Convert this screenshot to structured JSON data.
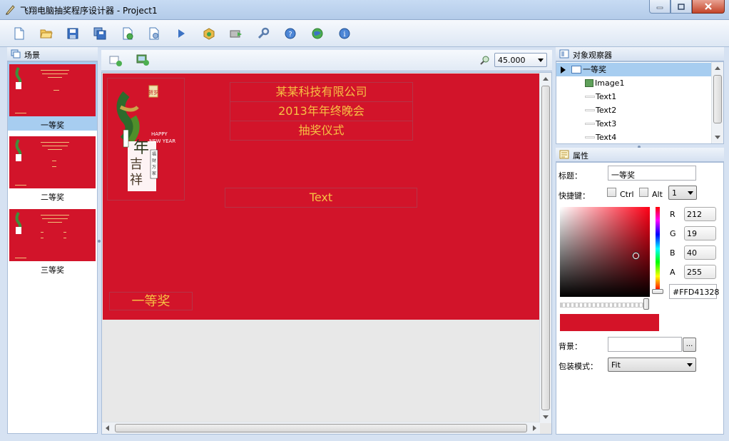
{
  "window": {
    "title": "飞翔电脑抽奖程序设计器 - Project1"
  },
  "colors": {
    "stage_red": "#D2142A",
    "text_gold": "#F6C043",
    "selection": "#A7CDF0"
  },
  "toolbar": {
    "icons": [
      "new-file-icon",
      "open-folder-icon",
      "save-icon",
      "save-all-icon",
      "export-icon",
      "settings-page-icon",
      "run-icon",
      "package-icon",
      "publish-icon",
      "wrench-icon",
      "help-icon",
      "globe-icon",
      "info-icon"
    ]
  },
  "scene_panel": {
    "title": "场景",
    "items": [
      {
        "label": "一等奖",
        "selected": true
      },
      {
        "label": "二等奖",
        "selected": false
      },
      {
        "label": "三等奖",
        "selected": false
      }
    ]
  },
  "canvas": {
    "zoom": "45.000",
    "logo_text": {
      "badge": "贺岁",
      "happy": "HAPPY",
      "new_year": "NEW YEAR",
      "main": "新年吉祥",
      "side": "福禄寿喜",
      "vertical": "福财万家"
    },
    "text1": "某某科技有限公司",
    "text2": "2013年年终晚会",
    "text3": "抽奖仪式",
    "text4": "Text",
    "prize_label": "一等奖"
  },
  "object_panel": {
    "title": "对象观察器",
    "root": "一等奖",
    "children": [
      "Image1",
      "Text1",
      "Text2",
      "Text3",
      "Text4"
    ]
  },
  "properties": {
    "title": "属性",
    "caption_label": "标题：",
    "caption_value": "一等奖",
    "hotkey_label": "快捷键：",
    "ctrl_label": "Ctrl",
    "alt_label": "Alt",
    "hotkey_value": "1",
    "color": {
      "r_label": "R",
      "g_label": "G",
      "b_label": "B",
      "a_label": "A",
      "r": "212",
      "g": "19",
      "b": "40",
      "a": "255",
      "hex": "#FFD41328",
      "swatch": "#D41328"
    },
    "background_label": "背景：",
    "background_value": "",
    "browse_label": "...",
    "pack_mode_label": "包装模式：",
    "pack_mode_value": "Fit"
  }
}
